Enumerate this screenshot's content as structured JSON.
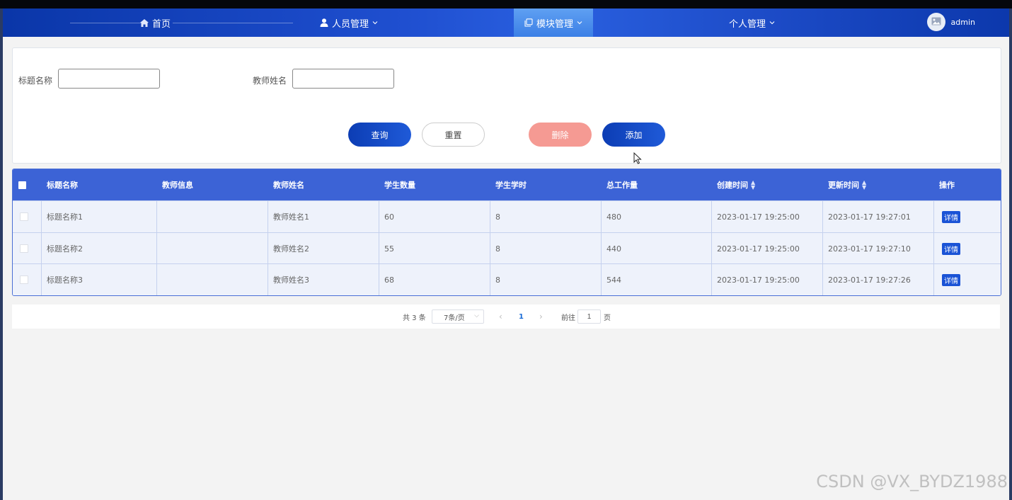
{
  "nav": {
    "home": "首页",
    "people": "人员管理",
    "module": "模块管理",
    "personal": "个人管理",
    "user": "admin"
  },
  "search": {
    "title_label": "标题名称",
    "title_value": "",
    "teacher_label": "教师姓名",
    "teacher_value": "",
    "query": "查询",
    "reset": "重置",
    "delete": "删除",
    "add": "添加"
  },
  "table": {
    "headers": [
      "标题名称",
      "教师信息",
      "教师姓名",
      "学生数量",
      "学生学时",
      "总工作量",
      "创建时间",
      "更新时间",
      "操作"
    ],
    "rows": [
      {
        "title": "标题名称1",
        "info": "",
        "teacher": "教师姓名1",
        "students": "60",
        "hours": "8",
        "workload": "480",
        "created": "2023-01-17 19:25:00",
        "updated": "2023-01-17 19:27:01",
        "action": "详情"
      },
      {
        "title": "标题名称2",
        "info": "",
        "teacher": "教师姓名2",
        "students": "55",
        "hours": "8",
        "workload": "440",
        "created": "2023-01-17 19:25:00",
        "updated": "2023-01-17 19:27:10",
        "action": "详情"
      },
      {
        "title": "标题名称3",
        "info": "",
        "teacher": "教师姓名3",
        "students": "68",
        "hours": "8",
        "workload": "544",
        "created": "2023-01-17 19:25:00",
        "updated": "2023-01-17 19:27:26",
        "action": "详情"
      }
    ]
  },
  "pagination": {
    "total": "共 3 条",
    "page_size": "7条/页",
    "prev": "‹",
    "current": "1",
    "next": "›",
    "goto_label": "前往",
    "goto_value": "1",
    "page_unit": "页"
  },
  "watermark": "CSDN @VX_BYDZ1988",
  "colors": {
    "nav_start": "#0a36a8",
    "nav_end": "#0c38ac",
    "active_tab": "#4a8ef0",
    "primary": "#1a53d6",
    "danger_light": "#f59a93",
    "table_header": "#3c63d6",
    "row_bg": "#eef2fb"
  },
  "icons": [
    "home-icon",
    "user-icon",
    "module-icon",
    "chevron-down-icon",
    "avatar-image-icon",
    "sort-icon",
    "pointer-cursor-icon"
  ]
}
